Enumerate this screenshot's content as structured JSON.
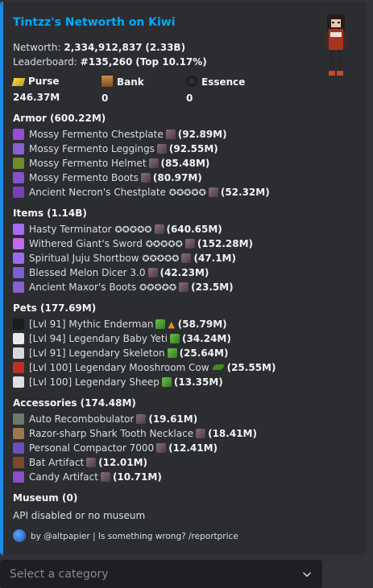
{
  "embed": {
    "title": "Tintzz's Networth on Kiwi",
    "networth_label": "Networth:",
    "networth_value": "2,334,912,837",
    "networth_short": "(2.33B)",
    "leaderboard_label": "Leaderboard:",
    "leaderboard_value": "#135,260",
    "leaderboard_top": "(Top 10.17%)"
  },
  "currencies": [
    {
      "label": "Purse",
      "value": "246.37M",
      "icon": "gold-ingot-icon",
      "color": "#e8c43a"
    },
    {
      "label": "Bank",
      "value": "0",
      "icon": "chest-icon",
      "color": "#b07a3f"
    },
    {
      "label": "Essence",
      "value": "0",
      "icon": "essence-icon",
      "color": "#1b1b1b"
    }
  ],
  "armor": {
    "header": "Armor (600.22M)",
    "items": [
      {
        "name": "Mossy Fermento Chestplate",
        "stars": "",
        "value": "(92.89M)",
        "color": "#9b4bd6"
      },
      {
        "name": "Mossy Fermento Leggings",
        "stars": "",
        "value": "(92.55M)",
        "color": "#8a5fd1"
      },
      {
        "name": "Mossy Fermento Helmet",
        "stars": "",
        "value": "(85.48M)",
        "color": "#6e8a2d"
      },
      {
        "name": "Mossy Fermento Boots",
        "stars": "",
        "value": "(80.97M)",
        "color": "#8a4fcb"
      },
      {
        "name": "Ancient Necron's Chestplate",
        "stars": "✪✪✪✪✪",
        "value": "(52.32M)",
        "color": "#7a3fb8"
      }
    ]
  },
  "items": {
    "header": "Items (1.14B)",
    "items": [
      {
        "name": "Hasty Terminator",
        "stars": "✪✪✪✪✪",
        "value": "(640.65M)",
        "color": "#a46bf0"
      },
      {
        "name": "Withered Giant's Sword",
        "stars": "✪✪✪✪✪",
        "value": "(152.28M)",
        "color": "#c06bf0"
      },
      {
        "name": "Spiritual Juju Shortbow",
        "stars": "✪✪✪✪✪",
        "value": "(47.1M)",
        "color": "#9a6bf0"
      },
      {
        "name": "Blessed Melon Dicer 3.0",
        "stars": "",
        "value": "(42.23M)",
        "color": "#7c5fd6"
      },
      {
        "name": "Ancient Maxor's Boots",
        "stars": "✪✪✪✪✪",
        "value": "(23.5M)",
        "color": "#8a5fd1"
      }
    ]
  },
  "pets": {
    "header": "Pets (177.69M)",
    "items": [
      {
        "name": "[Lvl 91] Mythic Enderman",
        "value": "(58.79M)",
        "color": "#1b1b24",
        "extra": "carrot"
      },
      {
        "name": "[Lvl 94] Legendary Baby Yeti",
        "value": "(34.24M)",
        "color": "#e8e8ef",
        "extra": ""
      },
      {
        "name": "[Lvl 91] Legendary Skeleton",
        "value": "(25.64M)",
        "color": "#d8d8d8",
        "extra": ""
      },
      {
        "name": "[Lvl 100] Legendary Mooshroom Cow",
        "value": "(25.55M)",
        "color": "#b8322a",
        "extra": "leaf"
      },
      {
        "name": "[Lvl 100] Legendary Sheep",
        "value": "(13.35M)",
        "color": "#e0e0e0",
        "extra": ""
      }
    ]
  },
  "accessories": {
    "header": "Accessories (174.48M)",
    "items": [
      {
        "name": "Auto Recombobulator",
        "value": "(19.61M)",
        "color": "#6c7a6a"
      },
      {
        "name": "Razor-sharp Shark Tooth Necklace",
        "value": "(18.41M)",
        "color": "#9c7a4a"
      },
      {
        "name": "Personal Compactor 7000",
        "value": "(12.41M)",
        "color": "#6a4fb8"
      },
      {
        "name": "Bat Artifact",
        "value": "(12.01M)",
        "color": "#7a4a2a"
      },
      {
        "name": "Candy Artifact",
        "value": "(10.71M)",
        "color": "#8a4fcb"
      }
    ]
  },
  "museum": {
    "header": "Museum (0)",
    "text": "API disabled or no museum"
  },
  "footer": {
    "text": "by @altpapier | Is something wrong? /reportprice"
  },
  "select": {
    "placeholder": "Select a category"
  }
}
